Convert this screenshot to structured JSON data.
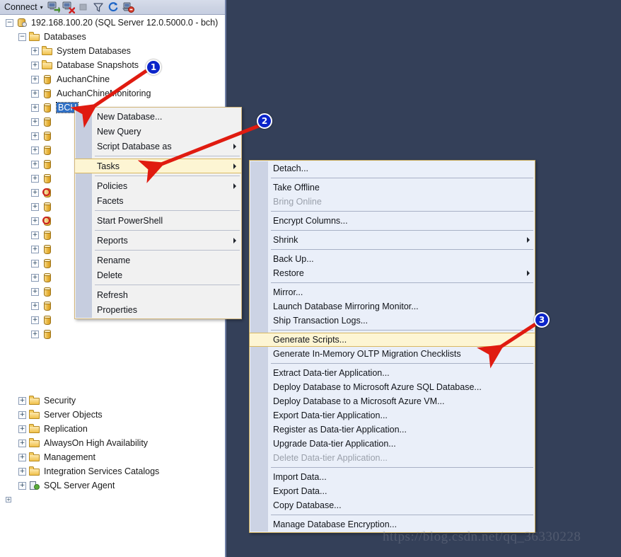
{
  "toolbar": {
    "connect_label": "Connect",
    "caret": "▾",
    "icons": [
      {
        "name": "connect-object-explorer-icon",
        "glyph": "connect"
      },
      {
        "name": "disconnect-object-explorer-icon",
        "glyph": "disconnect"
      },
      {
        "name": "stop-icon",
        "glyph": "stop"
      },
      {
        "name": "filter-icon",
        "glyph": "filter"
      },
      {
        "name": "refresh-icon",
        "glyph": "refresh"
      },
      {
        "name": "disconnect-all-icon",
        "glyph": "disconnect-all"
      }
    ]
  },
  "tree": {
    "server": {
      "label": "192.168.100.20 (SQL Server 12.0.5000.0 - bch)",
      "expander": "−",
      "icon": "server-icon"
    },
    "databases": {
      "label": "Databases",
      "expander": "−",
      "icon": "folder-icon"
    },
    "db_children": [
      {
        "label": "System Databases",
        "icon": "folder-icon",
        "expander": "+"
      },
      {
        "label": "Database Snapshots",
        "icon": "folder-icon",
        "expander": "+"
      },
      {
        "label": "AuchanChine",
        "icon": "database-icon",
        "expander": "+"
      },
      {
        "label": "AuchanChineMonitoring",
        "icon": "database-icon",
        "expander": "+"
      },
      {
        "label": "BCH",
        "icon": "database-icon",
        "expander": "+",
        "selected": true
      },
      {
        "label": "",
        "icon": "database-icon",
        "expander": "+"
      },
      {
        "label": "",
        "icon": "database-icon",
        "expander": "+"
      },
      {
        "label": "",
        "icon": "database-icon",
        "expander": "+"
      },
      {
        "label": "",
        "icon": "database-icon",
        "expander": "+"
      },
      {
        "label": "",
        "icon": "database-icon",
        "expander": "+"
      },
      {
        "label": "",
        "icon": "database-error-icon",
        "expander": "+"
      },
      {
        "label": "",
        "icon": "database-icon",
        "expander": "+"
      },
      {
        "label": "",
        "icon": "database-error-icon",
        "expander": "+"
      },
      {
        "label": "",
        "icon": "database-icon",
        "expander": "+"
      },
      {
        "label": "",
        "icon": "database-icon",
        "expander": "+"
      },
      {
        "label": "",
        "icon": "database-icon",
        "expander": "+"
      },
      {
        "label": "",
        "icon": "database-icon",
        "expander": "+"
      },
      {
        "label": "",
        "icon": "database-icon",
        "expander": "+"
      },
      {
        "label": "",
        "icon": "database-icon",
        "expander": "+"
      },
      {
        "label": "",
        "icon": "database-icon",
        "expander": "+"
      },
      {
        "label": "",
        "icon": "database-icon",
        "expander": "+"
      }
    ],
    "server_children": [
      {
        "label": "Security",
        "icon": "folder-icon",
        "expander": "+"
      },
      {
        "label": "Server Objects",
        "icon": "folder-icon",
        "expander": "+"
      },
      {
        "label": "Replication",
        "icon": "folder-icon",
        "expander": "+"
      },
      {
        "label": "AlwaysOn High Availability",
        "icon": "folder-icon",
        "expander": "+"
      },
      {
        "label": "Management",
        "icon": "folder-icon",
        "expander": "+"
      },
      {
        "label": "Integration Services Catalogs",
        "icon": "folder-icon",
        "expander": "+"
      },
      {
        "label": "SQL Server Agent",
        "icon": "sql-server-agent-icon",
        "expander": "+"
      }
    ],
    "trailing_expander": "+"
  },
  "context_menu": {
    "items": [
      {
        "label": "New Database...",
        "type": "item"
      },
      {
        "label": "New Query",
        "type": "item"
      },
      {
        "label": "Script Database as",
        "type": "item",
        "submenu": true
      },
      {
        "type": "separator"
      },
      {
        "label": "Tasks",
        "type": "item",
        "submenu": true,
        "highlighted": true
      },
      {
        "type": "separator"
      },
      {
        "label": "Policies",
        "type": "item",
        "submenu": true
      },
      {
        "label": "Facets",
        "type": "item"
      },
      {
        "type": "separator"
      },
      {
        "label": "Start PowerShell",
        "type": "item"
      },
      {
        "type": "separator"
      },
      {
        "label": "Reports",
        "type": "item",
        "submenu": true
      },
      {
        "type": "separator"
      },
      {
        "label": "Rename",
        "type": "item"
      },
      {
        "label": "Delete",
        "type": "item"
      },
      {
        "type": "separator"
      },
      {
        "label": "Refresh",
        "type": "item"
      },
      {
        "label": "Properties",
        "type": "item"
      }
    ]
  },
  "tasks_submenu": {
    "items": [
      {
        "label": "Detach...",
        "type": "item"
      },
      {
        "type": "separator"
      },
      {
        "label": "Take Offline",
        "type": "item"
      },
      {
        "label": "Bring Online",
        "type": "item",
        "disabled": true
      },
      {
        "type": "separator"
      },
      {
        "label": "Encrypt Columns...",
        "type": "item"
      },
      {
        "type": "separator"
      },
      {
        "label": "Shrink",
        "type": "item",
        "submenu": true
      },
      {
        "type": "separator"
      },
      {
        "label": "Back Up...",
        "type": "item"
      },
      {
        "label": "Restore",
        "type": "item",
        "submenu": true
      },
      {
        "type": "separator"
      },
      {
        "label": "Mirror...",
        "type": "item"
      },
      {
        "label": "Launch Database Mirroring Monitor...",
        "type": "item"
      },
      {
        "label": "Ship Transaction Logs...",
        "type": "item"
      },
      {
        "type": "separator"
      },
      {
        "label": "Generate Scripts...",
        "type": "item",
        "highlighted": true
      },
      {
        "label": "Generate In-Memory OLTP Migration Checklists",
        "type": "item"
      },
      {
        "type": "separator"
      },
      {
        "label": "Extract Data-tier Application...",
        "type": "item"
      },
      {
        "label": "Deploy Database to Microsoft Azure SQL Database...",
        "type": "item"
      },
      {
        "label": "Deploy Database to a Microsoft Azure VM...",
        "type": "item"
      },
      {
        "label": "Export Data-tier Application...",
        "type": "item"
      },
      {
        "label": "Register as Data-tier Application...",
        "type": "item"
      },
      {
        "label": "Upgrade Data-tier Application...",
        "type": "item"
      },
      {
        "label": "Delete Data-tier Application...",
        "type": "item",
        "disabled": true
      },
      {
        "type": "separator"
      },
      {
        "label": "Import Data...",
        "type": "item"
      },
      {
        "label": "Export Data...",
        "type": "item"
      },
      {
        "label": "Copy Database...",
        "type": "item"
      },
      {
        "type": "separator"
      },
      {
        "label": "Manage Database Encryption...",
        "type": "item"
      }
    ]
  },
  "annotations": {
    "badges": [
      {
        "label": "1",
        "name": "step-badge-1"
      },
      {
        "label": "2",
        "name": "step-badge-2"
      },
      {
        "label": "3",
        "name": "step-badge-3"
      }
    ],
    "arrow_color": "#e01b10"
  },
  "watermark": {
    "text": "https://blog.csdn.net/qq_36330228"
  },
  "colors": {
    "background": "#344059",
    "toolbar": "#ccd3e3",
    "menu_bg": "#f1f1f1",
    "submenu_bg": "#eaeff9",
    "highlight": "#fdf5d3",
    "highlight_border": "#d9b861",
    "selection": "#2f6fc4",
    "badge": "#0b24c9"
  }
}
